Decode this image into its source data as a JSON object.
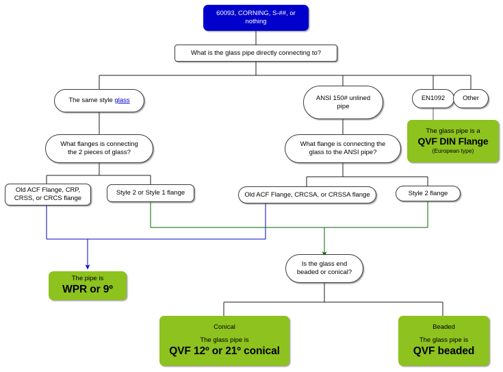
{
  "diagram": {
    "title": "Glass pipe identification flowchart",
    "colors": {
      "start_fill": "#0000CC",
      "result_fill": "#8DC21F",
      "node_stroke": "#3A3A3A",
      "edge_default": "#1A1A1A",
      "edge_blue": "#0000CC",
      "edge_green": "#006600"
    }
  },
  "nodes": {
    "start": {
      "line1": "60093, CORNING, S-##, or",
      "line2": "nothing"
    },
    "q_connecting_to": {
      "text": "What is the glass pipe directly connecting to?"
    },
    "opt_same_style": {
      "prefix": "The same style ",
      "link": "glass"
    },
    "opt_ansi": {
      "line1": "ANSI 150# unlined",
      "line2": "pipe"
    },
    "opt_en1092": {
      "text": "EN1092"
    },
    "opt_other": {
      "text": "Other"
    },
    "q_flanges_glass": {
      "line1": "What flanges is connecting",
      "line2": "the 2 pieces of glass?"
    },
    "q_flange_ansi": {
      "line1": "What flange is connecting the",
      "line2": "glass to the ANSI pipe?"
    },
    "result_din": {
      "line1": "The glass pipe is a",
      "line2": "QVF DIN Flange",
      "line3": "(European type)"
    },
    "flange_old_acf_left": {
      "line1": "Old ACF Flange, CRP,",
      "line2": "CRSS, or CRCS flange"
    },
    "flange_style21": {
      "text": "Style 2 or Style 1 flange"
    },
    "flange_old_acf_right": {
      "text": "Old ACF Flange, CRCSA, or CRSSA flange"
    },
    "flange_style2": {
      "text": "Style 2 flange"
    },
    "result_wpr": {
      "line1": "The pipe is",
      "line2": "WPR or 9º"
    },
    "q_beaded_conical": {
      "line1": "Is the glass end",
      "line2": "beaded or conical?"
    },
    "result_conical": {
      "label": "Conical",
      "line1": "The glass pipe is",
      "line2": "QVF 12º or 21º conical"
    },
    "result_beaded": {
      "label": "Beaded",
      "line1": "The glass pipe is",
      "line2": "QVF beaded"
    }
  }
}
